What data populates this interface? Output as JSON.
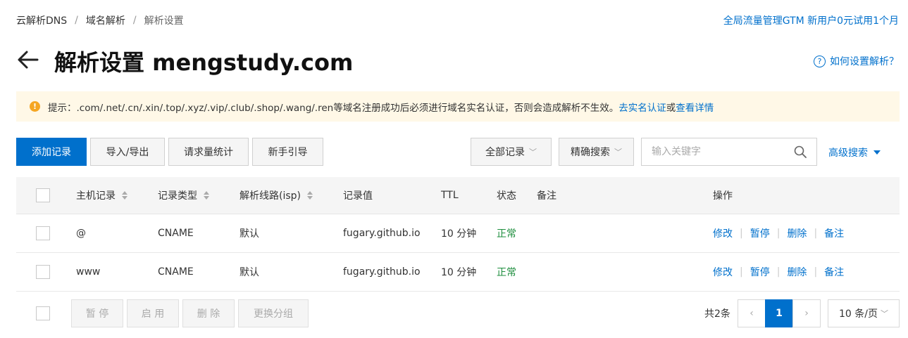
{
  "breadcrumb": [
    "云解析DNS",
    "域名解析",
    "解析设置"
  ],
  "promo_link": "全局流量管理GTM 新用户0元试用1个月",
  "page_title": "解析设置 mengstudy.com",
  "help_link": "如何设置解析？",
  "notice": {
    "text": "提示：.com/.net/.cn/.xin/.top/.xyz/.vip/.club/.shop/.wang/.ren等域名注册成功后必须进行域名实名认证，否则会造成解析不生效。",
    "link1": "去实名认证",
    "connector": "或",
    "link2": "查看详情"
  },
  "toolbar": {
    "add": "添加记录",
    "import_export": "导入/导出",
    "stats": "请求量统计",
    "guide": "新手引导",
    "filter_all": "全部记录",
    "exact_search": "精确搜索",
    "search_placeholder": "输入关键字",
    "advanced_search": "高级搜索"
  },
  "table": {
    "headers": {
      "host": "主机记录",
      "type": "记录类型",
      "line": "解析线路(isp)",
      "value": "记录值",
      "ttl": "TTL",
      "status": "状态",
      "remark": "备注",
      "actions": "操作"
    },
    "rows": [
      {
        "host": "@",
        "type": "CNAME",
        "line": "默认",
        "value": "fugary.github.io",
        "ttl": "10 分钟",
        "status": "正常",
        "remark": ""
      },
      {
        "host": "www",
        "type": "CNAME",
        "line": "默认",
        "value": "fugary.github.io",
        "ttl": "10 分钟",
        "status": "正常",
        "remark": ""
      }
    ],
    "actions": {
      "edit": "修改",
      "pause": "暂停",
      "delete": "删除",
      "remark": "备注"
    }
  },
  "footer": {
    "batch_pause": "暂 停",
    "batch_enable": "启 用",
    "batch_delete": "删 除",
    "change_group": "更换分组",
    "total": "共2条",
    "prev": "‹",
    "current_page": "1",
    "next": "›",
    "page_size": "10 条/页"
  },
  "colors": {
    "accent": "#0070cc",
    "status_ok": "#1e8e3e",
    "notice_bg": "#fff8e7",
    "warn": "#f5a623"
  },
  "icons": [
    "back-arrow-icon",
    "question-icon",
    "warning-icon",
    "search-icon",
    "caret-down-icon",
    "sort-icon"
  ]
}
